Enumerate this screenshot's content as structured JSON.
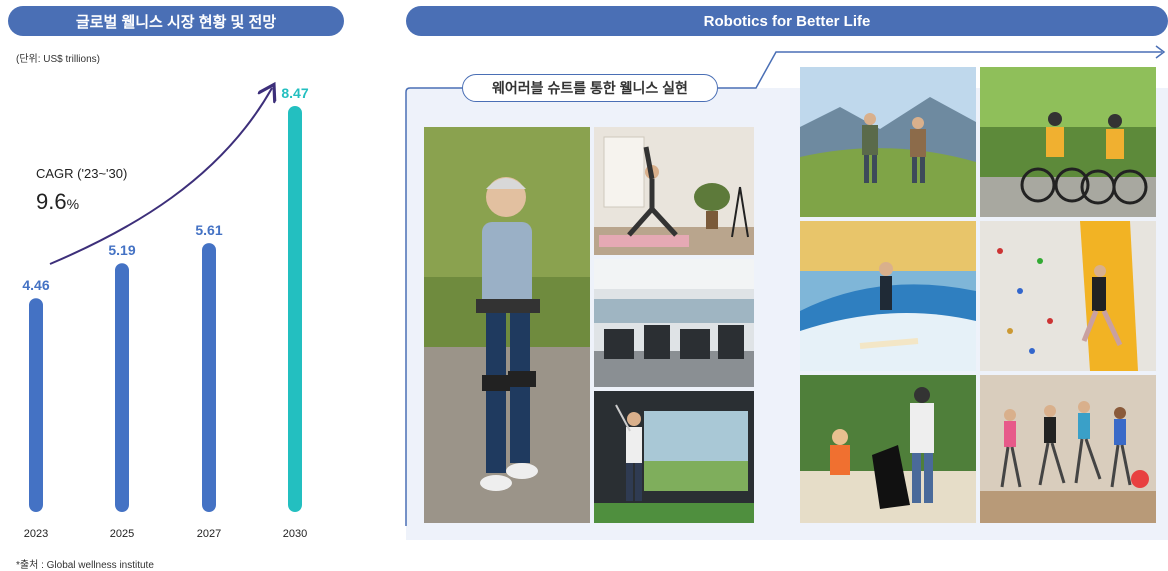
{
  "left": {
    "title": "글로벌 웰니스 시장 현황 및 전망",
    "unit": "(단위: US$ trillions)",
    "source": "*출처 : Global wellness institute",
    "cagr_label": "CAGR ('23~'30)",
    "cagr_value": "9.6",
    "cagr_unit": "%"
  },
  "right": {
    "title": "Robotics for Better Life",
    "subtitle": "웨어러블 슈트를 통한 웰니스 실현"
  },
  "colors": {
    "accent": "#4a6fb5",
    "bar": "#4472c4",
    "highlight": "#23bfc0",
    "panel": "#eef2fa"
  },
  "photos": [
    {
      "name": "photo-walking-woman-wearable-suit",
      "icon": "walking-person"
    },
    {
      "name": "photo-yoga-lunge",
      "icon": "yoga-person"
    },
    {
      "name": "photo-fitness-gym",
      "icon": "gym-machines"
    },
    {
      "name": "photo-golf-simulator",
      "icon": "golfer"
    },
    {
      "name": "photo-hiking-couple",
      "icon": "hikers"
    },
    {
      "name": "photo-cycling-couple",
      "icon": "cyclists"
    },
    {
      "name": "photo-indoor-surfing",
      "icon": "surfer"
    },
    {
      "name": "photo-climbing-wall",
      "icon": "climber"
    },
    {
      "name": "photo-beach-cleanup",
      "icon": "volunteers"
    },
    {
      "name": "photo-aerobics-class",
      "icon": "dancers"
    }
  ],
  "chart_data": {
    "type": "bar",
    "categories": [
      "2023",
      "2025",
      "2027",
      "2030"
    ],
    "values": [
      4.46,
      5.19,
      5.61,
      8.47
    ],
    "title": "글로벌 웰니스 시장 현황 및 전망",
    "xlabel": "",
    "ylabel": "",
    "ylim": [
      0,
      8.47
    ],
    "grid": false,
    "legend": "none",
    "highlight_index": 3
  }
}
